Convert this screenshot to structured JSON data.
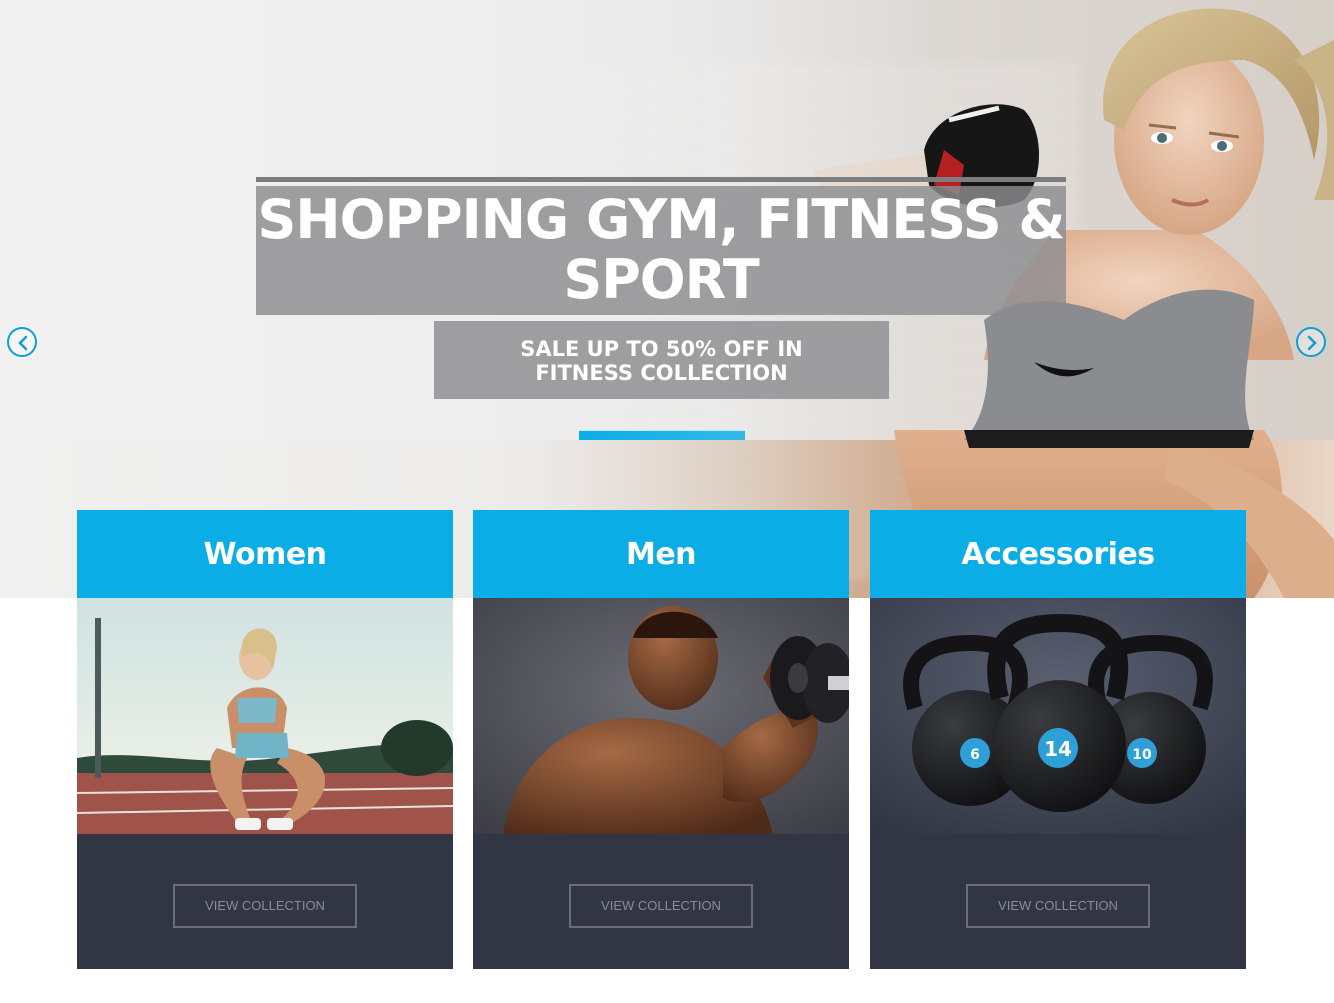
{
  "hero": {
    "title": "SHOPPING GYM, FITNESS & SPORT",
    "subtitle": "SALE UP TO 50% OFF IN FITNESS COLLECTION",
    "prev_icon": "chevron-left-icon",
    "next_icon": "chevron-right-icon"
  },
  "categories": [
    {
      "title": "Women",
      "button": "VIEW COLLECTION",
      "image": "woman-runner-on-track"
    },
    {
      "title": "Men",
      "button": "VIEW COLLECTION",
      "image": "man-lifting-dumbbell"
    },
    {
      "title": "Accessories",
      "button": "VIEW COLLECTION",
      "image": "kettlebells"
    }
  ],
  "kettlebell_labels": [
    "6",
    "14",
    "10"
  ],
  "colors": {
    "accent": "#0aade5",
    "card_bg": "#323543",
    "overlay": "#8c8c90"
  }
}
